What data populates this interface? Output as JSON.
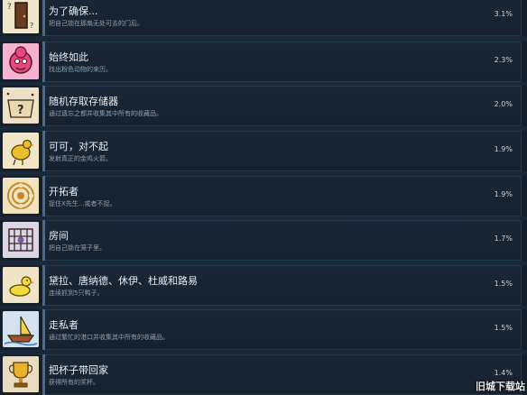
{
  "achievements": [
    {
      "title": "为了确保...",
      "desc": "把自己锁在那扇无处可去的门后。",
      "pct": "3.1%",
      "icon": "door-icon"
    },
    {
      "title": "始终如此",
      "desc": "找出粉色动物的来历。",
      "pct": "2.3%",
      "icon": "pink-face-icon"
    },
    {
      "title": "随机存取存储器",
      "desc": "通过遗忘之都并收集其中所有的收藏品。",
      "pct": "2.0%",
      "icon": "question-box-icon"
    },
    {
      "title": "可可，对不起",
      "desc": "发射真正的金鸡火箭。",
      "pct": "1.9%",
      "icon": "golden-chicken-icon"
    },
    {
      "title": "开拓者",
      "desc": "捉住X先生...或者不捉。",
      "pct": "1.9%",
      "icon": "maze-icon"
    },
    {
      "title": "房间",
      "desc": "把自己锁在笼子里。",
      "pct": "1.7%",
      "icon": "cage-icon"
    },
    {
      "title": "黛拉、唐纳德、休伊、杜威和路易",
      "desc": "连续抓到5只鸭子。",
      "pct": "1.5%",
      "icon": "duck-icon"
    },
    {
      "title": "走私者",
      "desc": "通过繁忙的港口并收集其中所有的收藏品。",
      "pct": "1.5%",
      "icon": "ship-icon"
    },
    {
      "title": "把杯子带回家",
      "desc": "获得所有的奖杯。",
      "pct": "1.4%",
      "icon": "trophy-icon"
    }
  ],
  "watermark": "旧城下载站"
}
